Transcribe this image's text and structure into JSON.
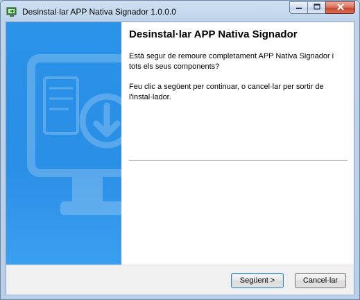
{
  "window": {
    "title": "Desinstal·lar APP Nativa Signador 1.0.0.0"
  },
  "icons": {
    "app": "uninstall-app-icon",
    "minimize": "minimize-icon",
    "maximize": "maximize-icon",
    "close": "close-icon",
    "banner": "monitor-download-icon"
  },
  "content": {
    "heading": "Desinstal·lar APP Nativa Signador",
    "paragraph1": "Està segur de remoure completament APP Nativa Signador i tots els seus components?",
    "paragraph2": "Feu clic a següent per continuar, o cancel·lar per sortir de l'instal·lador."
  },
  "buttons": {
    "next": "Següent >",
    "cancel": "Cancel·lar"
  },
  "colors": {
    "banner": "#2a8fe6",
    "close": "#c7452f"
  }
}
